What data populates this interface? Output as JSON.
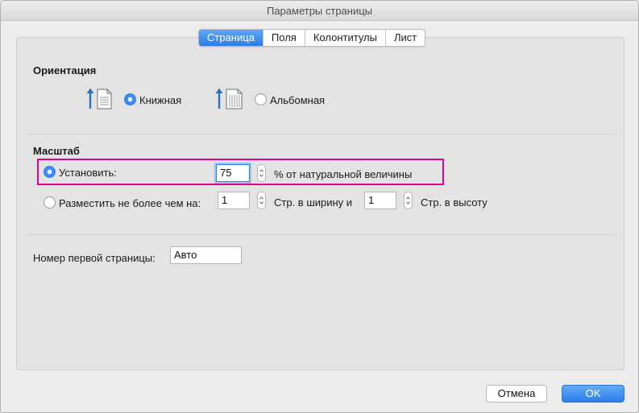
{
  "window": {
    "title": "Параметры страницы"
  },
  "tabs": [
    {
      "label": "Страница",
      "active": true
    },
    {
      "label": "Поля",
      "active": false
    },
    {
      "label": "Колонтитулы",
      "active": false
    },
    {
      "label": "Лист",
      "active": false
    }
  ],
  "orientation": {
    "title": "Ориентация",
    "portrait_label": "Книжная",
    "portrait_selected": true,
    "landscape_label": "Альбомная",
    "landscape_selected": false
  },
  "scale": {
    "title": "Масштаб",
    "adjust_label": "Установить:",
    "adjust_selected": true,
    "adjust_value": "75",
    "adjust_suffix": "% от натуральной величины",
    "fit_label": "Разместить не более чем на:",
    "fit_selected": false,
    "fit_wide_value": "1",
    "fit_wide_suffix": "Стр. в ширину и",
    "fit_tall_value": "1",
    "fit_tall_suffix": "Стр. в высоту"
  },
  "first_page_number": {
    "label": "Номер первой страницы:",
    "value": "Авто"
  },
  "buttons": {
    "cancel": "Отмена",
    "ok": "OK"
  },
  "colors": {
    "accent": "#2f7fe6",
    "highlight": "#e3008c"
  }
}
